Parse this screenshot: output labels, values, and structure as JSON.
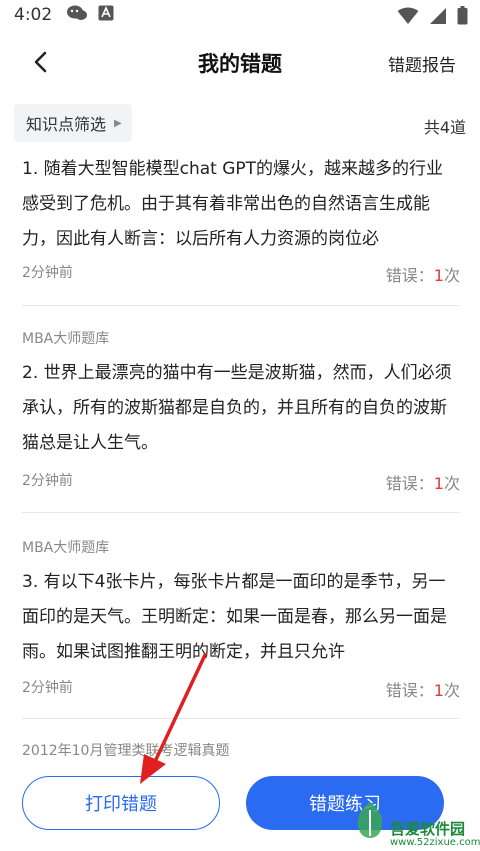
{
  "status_bar": {
    "time": "4:02",
    "left_icons": [
      "chat-bubble-icon",
      "app-a-icon"
    ],
    "right_icons": [
      "wifi-icon",
      "signal-icon",
      "battery-icon"
    ]
  },
  "header": {
    "back_icon": "chevron-left-icon",
    "title": "我的错题",
    "report_label": "错题报告"
  },
  "filter": {
    "label": "知识点筛选",
    "arrow": "▶",
    "total": "共4道"
  },
  "questions": [
    {
      "source": "",
      "text": "1. 随着大型智能模型chat GPT的爆火，越来越多的行业感受到了危机。由于其有着非常出色的自然语言生成能力，因此有人断言：以后所有人力资源的岗位必",
      "time": "2分钟前",
      "errors_label": "错误：",
      "errors_count": "1",
      "errors_unit": "次"
    },
    {
      "source": "MBA大师题库",
      "text": "2. 世界上最漂亮的猫中有一些是波斯猫，然而，人们必须承认，所有的波斯猫都是自负的，并且所有的自负的波斯猫总是让人生气。",
      "time": "2分钟前",
      "errors_label": "错误：",
      "errors_count": "1",
      "errors_unit": "次"
    },
    {
      "source": "MBA大师题库",
      "text": "3. 有以下4张卡片，每张卡片都是一面印的是季节，另一面印的是天气。王明断定：如果一面是春，那么另一面是雨。如果试图推翻王明的断定，并且只允许",
      "time": "2分钟前",
      "errors_label": "错误：",
      "errors_count": "1",
      "errors_unit": "次"
    },
    {
      "source": "2012年10月管理类联考逻辑真题"
    }
  ],
  "bottom": {
    "print_label": "打印错题",
    "practice_label": "错题练习"
  },
  "watermark": {
    "name": "吾爱软件园",
    "url": "www.52zixue.com"
  },
  "colors": {
    "accent": "#2a6bf2",
    "error_red": "#e53935",
    "annotation_red": "#e02020"
  }
}
